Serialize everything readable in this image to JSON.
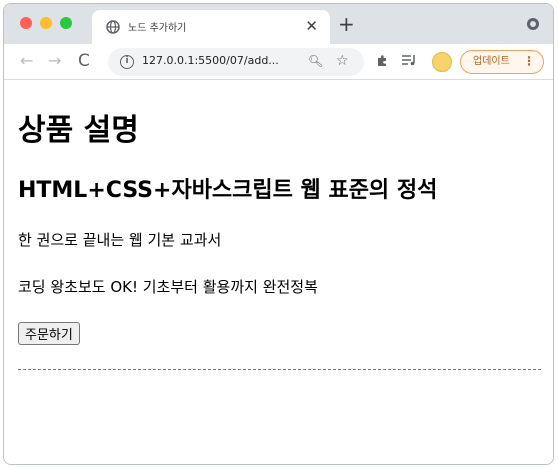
{
  "browser": {
    "tab": {
      "title": "노드 추가하기",
      "favicon": "globe-icon"
    },
    "url": "127.0.0.1:5500/07/add...",
    "update_label": "업데이트",
    "colors": {
      "tabstrip": "#dee1e6",
      "update_accent": "#e8a25b"
    }
  },
  "page": {
    "heading1": "상품 설명",
    "heading2": "HTML+CSS+자바스크립트 웹 표준의 정석",
    "paragraph1": "한 권으로 끝내는 웹 기본 교과서",
    "paragraph2": "코딩 왕초보도 OK! 기초부터 활용까지 완전정복",
    "order_button": "주문하기"
  }
}
